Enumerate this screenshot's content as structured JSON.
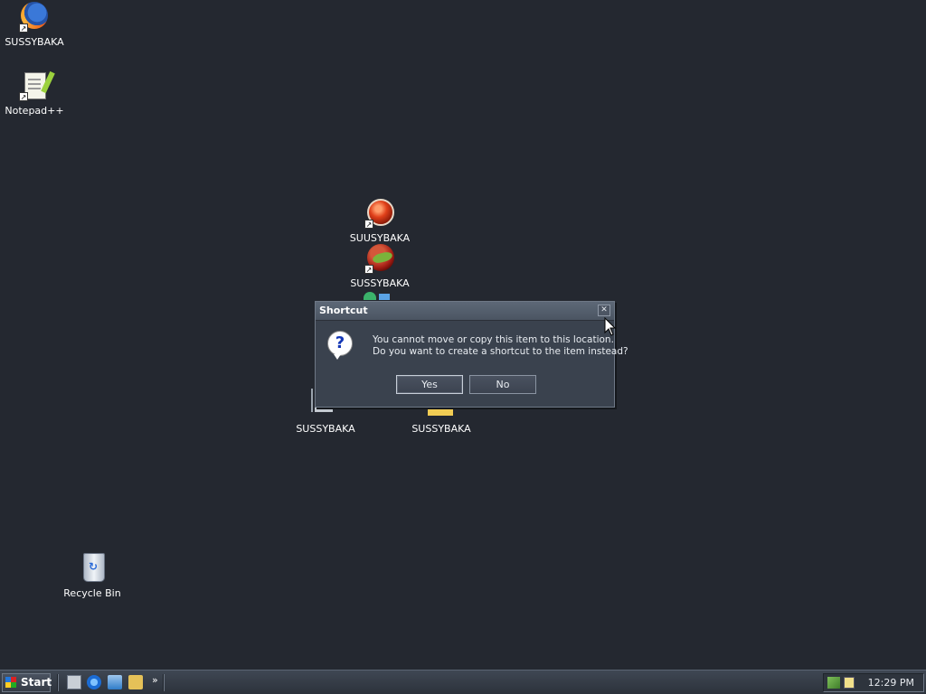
{
  "desktop": {
    "icons": [
      {
        "label": "SUSSYBAKA",
        "icon": "firefox-icon"
      },
      {
        "label": "Notepad++",
        "icon": "notepad-plus-plus-icon"
      },
      {
        "label": "SUUSYBAKA",
        "icon": "red-orb-icon"
      },
      {
        "label": "SUSSYBAKA",
        "icon": "melon-orb-icon"
      },
      {
        "label": "SUSSYBAKA",
        "icon": "computer-icon"
      },
      {
        "label": "SUSSYBAKA",
        "icon": "folder-icon"
      },
      {
        "label": "Recycle Bin",
        "icon": "recycle-bin-icon"
      }
    ]
  },
  "dialog": {
    "title": "Shortcut",
    "close_symbol": "✕",
    "question_symbol": "?",
    "message_line1": "You cannot move or copy this item to this location.",
    "message_line2": "Do you want to create a shortcut to the item instead?",
    "yes_label": "Yes",
    "no_label": "No"
  },
  "taskbar": {
    "start_label": "Start",
    "quick_launch": [
      "show-desktop-icon",
      "internet-explorer-icon",
      "outlook-express-icon",
      "search-icon"
    ],
    "more_symbol": "»",
    "clock": "12:29 PM"
  },
  "colors": {
    "desktop_bg": "#242830",
    "dialog_bg": "#3a424e",
    "taskbar_bg": "#353b45"
  }
}
